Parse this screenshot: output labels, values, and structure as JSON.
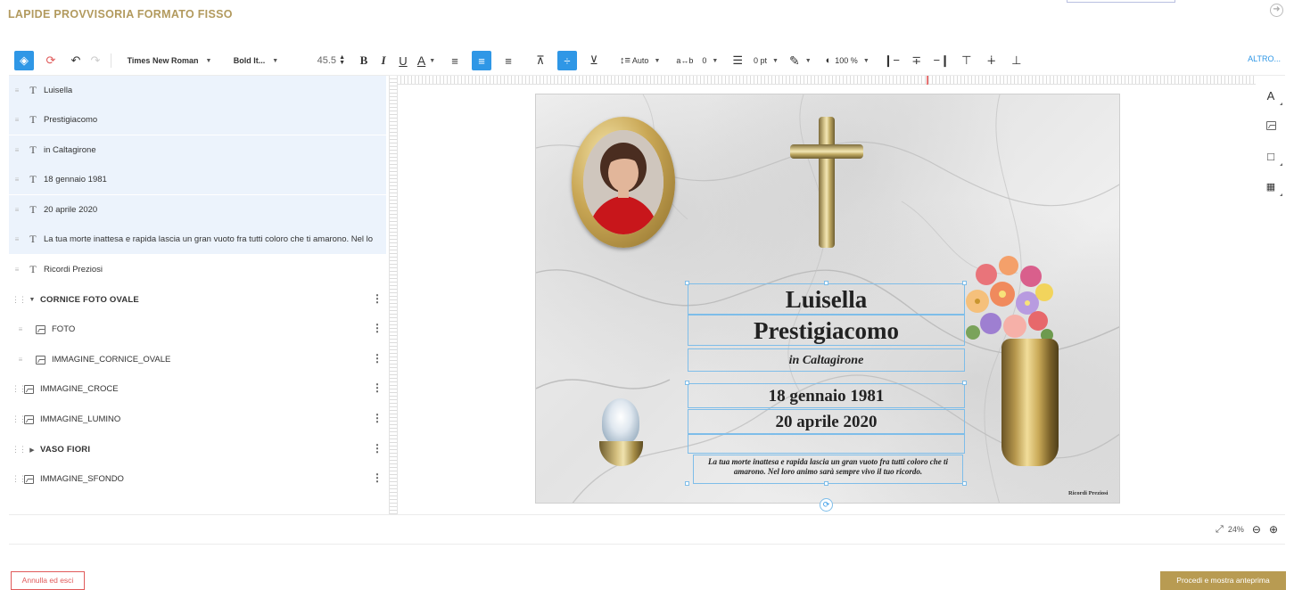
{
  "header": {
    "title": "LAPIDE PROVVISORIA FORMATO FISSO",
    "exit_icon": "exit-circle-arrow-icon"
  },
  "toolbar": {
    "font_family": "Times New Roman",
    "font_style": "Bold It...",
    "font_size": "45.5",
    "line_spacing": "Auto",
    "letter_spacing": "0",
    "stroke_width": "0 pt",
    "opacity": "100 %",
    "more_label": "ALTRO...",
    "bold": "B",
    "italic": "I",
    "underline": "U",
    "text_color": "A",
    "active_color": "#2f97e6"
  },
  "layers": [
    {
      "label": "Luisella",
      "type": "text"
    },
    {
      "label": "Prestigiacomo",
      "type": "text"
    },
    {
      "label": "in Caltagirone",
      "type": "text"
    },
    {
      "label": "18 gennaio 1981",
      "type": "text"
    },
    {
      "label": "20 aprile 2020",
      "type": "text"
    },
    {
      "label": "La tua morte inattesa e rapida lascia un gran vuoto fra tutti coloro che ti amarono. Nel lo",
      "type": "text"
    },
    {
      "label": "Ricordi Preziosi",
      "type": "text"
    },
    {
      "label": "CORNICE FOTO OVALE",
      "type": "group-open"
    },
    {
      "label": "FOTO",
      "type": "image"
    },
    {
      "label": "IMMAGINE_CORNICE_OVALE",
      "type": "image"
    },
    {
      "label": "IMMAGINE_CROCE",
      "type": "image"
    },
    {
      "label": "IMMAGINE_LUMINO",
      "type": "image"
    },
    {
      "label": "VASO FIORI",
      "type": "group-closed"
    },
    {
      "label": "IMMAGINE_SFONDO",
      "type": "image"
    }
  ],
  "slab": {
    "name_first": "Luisella",
    "name_last": "Prestigiacomo",
    "place": "in Caltagirone",
    "birth_date": "18 gennaio 1981",
    "death_date": "20 aprile 2020",
    "epitaph": "La tua morte inattesa e rapida lascia un gran vuoto fra tutti coloro che ti amarono. Nel loro animo sarà sempre vivo il tuo ricordo.",
    "signature": "Ricordi Preziosi"
  },
  "side_tools": [
    "text-tool-icon",
    "image-tool-icon",
    "shape-tool-icon",
    "qrcode-tool-icon"
  ],
  "zoom": {
    "level": "24%"
  },
  "footer": {
    "cancel_label": "Annulla ed esci",
    "proceed_label": "Procedi e mostra anteprima",
    "proceed_color": "#b89b52",
    "cancel_color": "#e05a5a"
  }
}
